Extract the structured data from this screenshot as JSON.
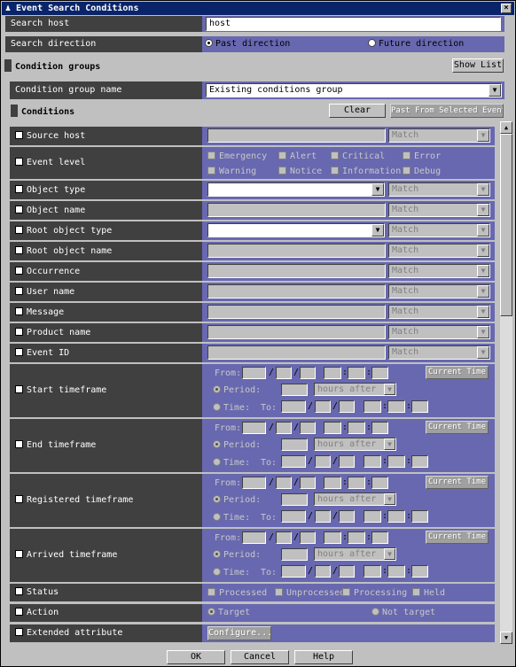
{
  "window": {
    "title": "Event Search Conditions",
    "close": "×"
  },
  "search_host": {
    "label": "Search host",
    "value": "host"
  },
  "direction": {
    "label": "Search direction",
    "past": "Past direction",
    "future": "Future direction"
  },
  "groups": {
    "title": "Condition groups",
    "show_list": "Show List",
    "name_label": "Condition group name",
    "name_value": "Existing conditions group"
  },
  "conditions": {
    "title": "Conditions",
    "clear": "Clear",
    "paste": "Past From Selected Event"
  },
  "rows": {
    "source_host": {
      "label": "Source host",
      "match": "Match"
    },
    "event_level": {
      "label": "Event level",
      "levels": [
        "Emergency",
        "Alert",
        "Critical",
        "Error",
        "Warning",
        "Notice",
        "Information",
        "Debug"
      ]
    },
    "object_type": {
      "label": "Object type",
      "match": "Match"
    },
    "object_name": {
      "label": "Object name",
      "match": "Match"
    },
    "root_object_type": {
      "label": "Root object type",
      "match": "Match"
    },
    "root_object_name": {
      "label": "Root object name",
      "match": "Match"
    },
    "occurrence": {
      "label": "Occurrence",
      "match": "Match"
    },
    "user_name": {
      "label": "User name",
      "match": "Match"
    },
    "message": {
      "label": "Message",
      "match": "Match"
    },
    "product_name": {
      "label": "Product name",
      "match": "Match"
    },
    "event_id": {
      "label": "Event ID",
      "match": "Match"
    },
    "start_tf": {
      "label": "Start timeframe"
    },
    "end_tf": {
      "label": "End timeframe"
    },
    "registered_tf": {
      "label": "Registered timeframe"
    },
    "arrived_tf": {
      "label": "Arrived timeframe"
    },
    "status": {
      "label": "Status",
      "opts": [
        "Processed",
        "Unprocessed",
        "Processing",
        "Held"
      ]
    },
    "action": {
      "label": "Action",
      "target": "Target",
      "not_target": "Not target"
    },
    "ext_attr": {
      "label": "Extended attribute",
      "configure": "Configure..."
    }
  },
  "timeframe": {
    "from": "From:",
    "current_time": "Current Time",
    "period": "Period:",
    "hours_after": "hours after",
    "time": "Time:",
    "to": "To:",
    "slash": "/",
    "colon": ":"
  },
  "footer": {
    "ok": "OK",
    "cancel": "Cancel",
    "help": "Help"
  },
  "scroll": {
    "up": "▲",
    "down": "▼"
  }
}
